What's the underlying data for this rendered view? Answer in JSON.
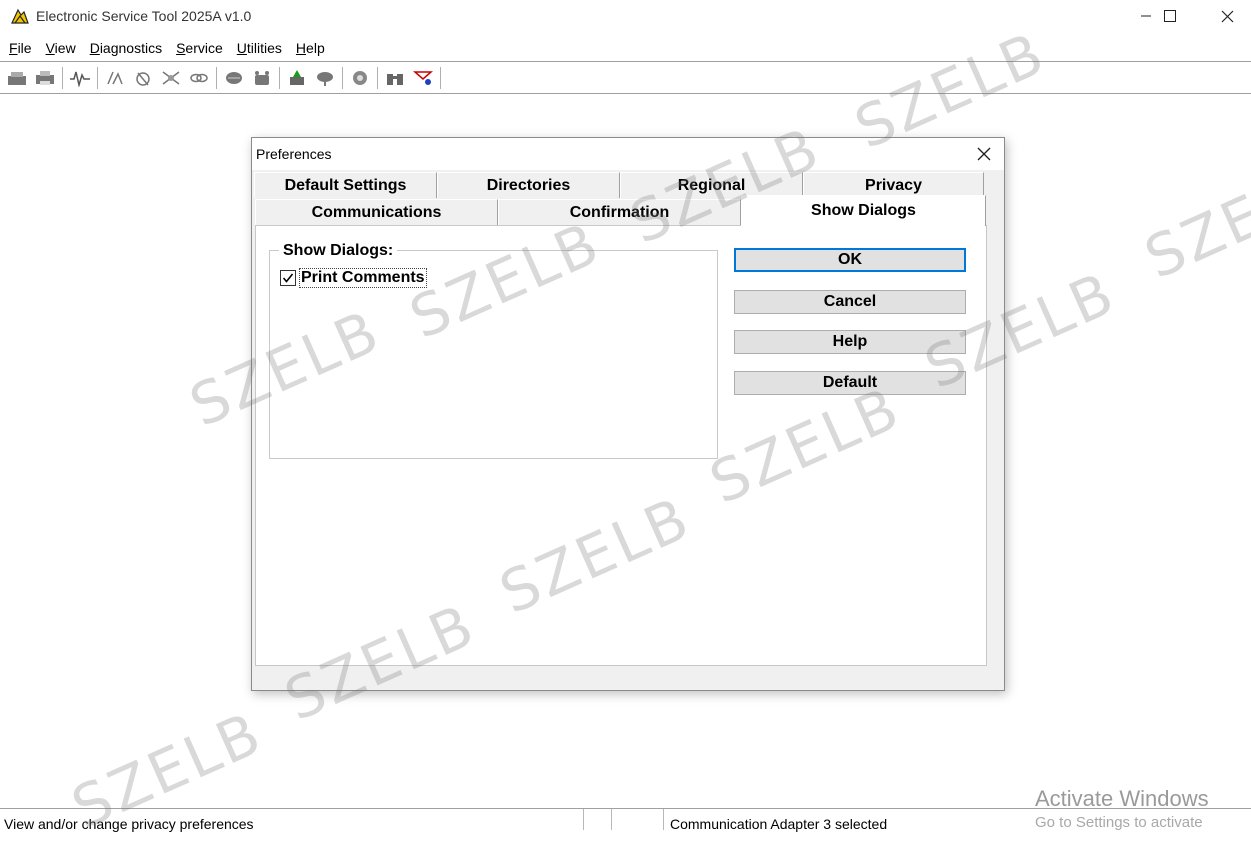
{
  "window": {
    "title": "Electronic Service Tool 2025A v1.0",
    "icon": "app-logo-icon",
    "controls": {
      "minimize": "minimize-icon",
      "maximize": "maximize-icon",
      "close": "close-icon"
    }
  },
  "menubar": {
    "items": [
      {
        "label": "File",
        "mnemonic": "F",
        "rest": "ile"
      },
      {
        "label": "View",
        "mnemonic": "V",
        "rest": "iew"
      },
      {
        "label": "Diagnostics",
        "mnemonic": "D",
        "rest": "iagnostics"
      },
      {
        "label": "Service",
        "mnemonic": "S",
        "rest": "ervice"
      },
      {
        "label": "Utilities",
        "mnemonic": "U",
        "rest": "tilities"
      },
      {
        "label": "Help",
        "mnemonic": "H",
        "rest": "elp"
      }
    ]
  },
  "toolbar": {
    "icons": [
      "connect-icon",
      "print-icon",
      "waveform-icon",
      "status-icon",
      "tests-icon",
      "calibration-icon",
      "link-icon",
      "data-link-icon",
      "ecm-icon",
      "flash-icon",
      "summary-icon",
      "config-icon",
      "binoculars-icon",
      "flag-icon"
    ]
  },
  "dialog": {
    "title": "Preferences",
    "tabs_row1": [
      "Default Settings",
      "Directories",
      "Regional",
      "Privacy"
    ],
    "tabs_row2": [
      "Communications",
      "Confirmation",
      "Show Dialogs"
    ],
    "active_tab": "Show Dialogs",
    "group_label": "Show Dialogs:",
    "checkbox": {
      "label": "Print Comments",
      "checked": true
    },
    "buttons": {
      "ok": "OK",
      "cancel": "Cancel",
      "help": "Help",
      "default": "Default"
    }
  },
  "statusbar": {
    "left": "View and/or change privacy preferences",
    "right": "Communication Adapter 3 selected"
  },
  "overlay": {
    "activate_title": "Activate Windows",
    "activate_sub": "Go to Settings to activate"
  },
  "watermark": "SZELB"
}
